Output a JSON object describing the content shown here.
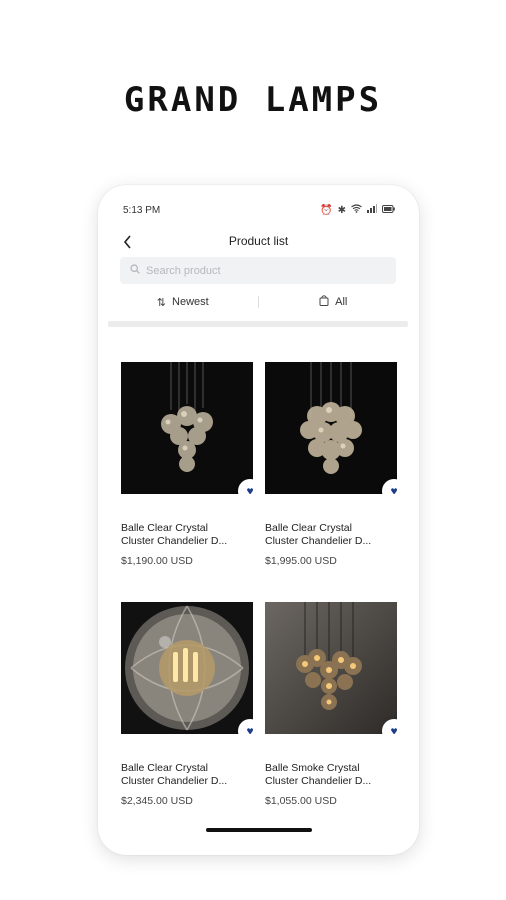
{
  "brand": {
    "logo_text": "GRAND LAMPS"
  },
  "status_bar": {
    "time": "5:13 PM",
    "icons": [
      "alarm-icon",
      "bluetooth-icon",
      "wifi-icon",
      "signal-icon",
      "battery-icon"
    ]
  },
  "header": {
    "title": "Product list",
    "back_icon": "chevron-left-icon"
  },
  "search": {
    "placeholder": "Search product",
    "value": ""
  },
  "filters": {
    "sort_label": "Newest",
    "category_label": "All"
  },
  "products": [
    {
      "name_line1": "Balle Clear Crystal",
      "name_line2": "Cluster Chandelier D...",
      "price": "$1,190.00 USD",
      "favorite": true
    },
    {
      "name_line1": "Balle Clear Crystal",
      "name_line2": "Cluster Chandelier D...",
      "price": "$1,995.00 USD",
      "favorite": true
    },
    {
      "name_line1": "Balle Clear Crystal",
      "name_line2": "Cluster Chandelier D...",
      "price": "$2,345.00 USD",
      "favorite": true
    },
    {
      "name_line1": "Balle Smoke Crystal",
      "name_line2": "Cluster Chandelier D...",
      "price": "$1,055.00 USD",
      "favorite": true
    }
  ],
  "colors": {
    "accent": "#1e3a8a",
    "search_bg": "#f1f2f4",
    "text": "#222222"
  }
}
